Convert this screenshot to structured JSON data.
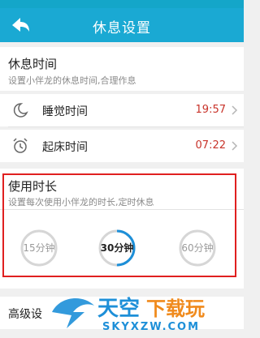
{
  "header": {
    "title": "休息设置",
    "back_icon": "back-arrow-icon"
  },
  "rest_time": {
    "title": "休息时间",
    "subtitle": "设置小伴龙的休息时间,合理作息",
    "items": [
      {
        "label": "睡觉时间",
        "value": "19:57",
        "icon": "moon-icon"
      },
      {
        "label": "起床时间",
        "value": "07:22",
        "icon": "alarm-clock-icon"
      }
    ]
  },
  "usage_duration": {
    "title": "使用时长",
    "subtitle": "设置每次使用小伴龙的时长,定时休息",
    "options": [
      {
        "label": "15分钟",
        "selected": false,
        "progress": 0
      },
      {
        "label": "30分钟",
        "selected": true,
        "progress": 0.5
      },
      {
        "label": "60分钟",
        "selected": false,
        "progress": 0
      }
    ]
  },
  "advanced": {
    "label": "高级设"
  },
  "watermark": {
    "main": "天空下载玩",
    "sub": "SKYXZW.COM"
  },
  "colors": {
    "header": "#1aa9d3",
    "accent": "#1d8fd8",
    "time_value": "#c8332a",
    "highlight_border": "#e02020"
  }
}
